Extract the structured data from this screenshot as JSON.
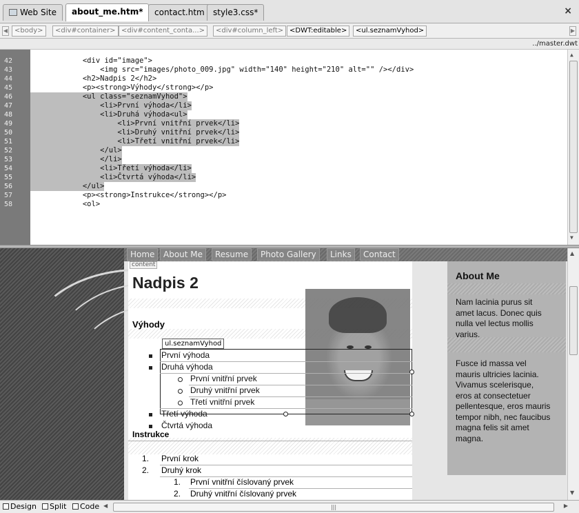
{
  "tabs": [
    {
      "label": "Web Site"
    },
    {
      "label": "about_me.htm*"
    },
    {
      "label": "contact.htm"
    },
    {
      "label": "style3.css*"
    }
  ],
  "close_label": "×",
  "tag_selector": [
    "<body>",
    "<div#container>",
    "<div#content_conta...>",
    "<div#column_left>",
    "<DWT:editable>",
    "<ul.seznamVyhod>"
  ],
  "template_path": "../master.dwt",
  "code_lines": [
    {
      "n": "42",
      "text": "            <div id=\"image\">"
    },
    {
      "n": "43",
      "text": "                <img src=\"images/photo_009.jpg\" width=\"140\" height=\"210\" alt=\"\" /></div>"
    },
    {
      "n": "44",
      "text": "            <h2>Nadpis 2</h2>"
    },
    {
      "n": "45",
      "text": "            <p><strong>Výhody</strong></p>"
    },
    {
      "n": "46",
      "text": "            <ul class=\"seznamVyhod\">"
    },
    {
      "n": "47",
      "text": "                <li>První výhoda</li>"
    },
    {
      "n": "48",
      "text": "                <li>Druhá výhoda<ul>"
    },
    {
      "n": "49",
      "text": "                    <li>První vnitřní prvek</li>"
    },
    {
      "n": "50",
      "text": "                    <li>Druhý vnitřní prvek</li>"
    },
    {
      "n": "51",
      "text": "                    <li>Třetí vnitřní prvek</li>"
    },
    {
      "n": "52",
      "text": "                </ul>"
    },
    {
      "n": "53",
      "text": "                </li>"
    },
    {
      "n": "54",
      "text": "                <li>Třetí výhoda</li>"
    },
    {
      "n": "55",
      "text": "                <li>Čtvrtá výhoda</li>"
    },
    {
      "n": "56",
      "text": "            </ul>"
    },
    {
      "n": "57",
      "text": "            <p><strong>Instrukce</strong></p>"
    },
    {
      "n": "58",
      "text": "            <ol>"
    }
  ],
  "nav": [
    "Home",
    "About Me",
    "Resume",
    "Photo Gallery",
    "Links",
    "Contact"
  ],
  "content_tag": "content",
  "heading": "Nadpis 2",
  "vyhody_label": "Výhody",
  "ul_tag_label": "ul.seznamVyhod",
  "list_items": [
    "První výhoda",
    "Druhá výhoda",
    "Třetí výhoda",
    "Čtvrtá výhoda"
  ],
  "inner_items": [
    "První vnitřní prvek",
    "Druhý vnitřní prvek",
    "Třetí vnitřní prvek"
  ],
  "instrukce_label": "Instrukce",
  "ol_items": [
    {
      "num": "1.",
      "text": "První krok"
    },
    {
      "num": "2.",
      "text": "Druhý krok"
    }
  ],
  "ol_inner": [
    {
      "num": "1.",
      "text": "První vnitřní číslovaný prvek"
    },
    {
      "num": "2.",
      "text": "Druhý vnitřní číslovaný prvek"
    }
  ],
  "sidebar": {
    "title": "About Me",
    "para1": [
      "Nam lacinia purus sit",
      "amet lacus. Donec quis",
      "nulla vel lectus mollis",
      "varius."
    ],
    "para2": [
      "Fusce id massa vel",
      "mauris ultricies lacinia.",
      "Vivamus scelerisque,",
      "eros at consectetuer",
      "pellentesque, eros mauris",
      "tempor nibh, nec faucibus",
      "magna felis sit amet",
      "magna."
    ]
  },
  "view_buttons": [
    "Design",
    "Split",
    "Code"
  ],
  "colors": {
    "gutter": "#7a7a7a",
    "selection": "#bdbdbd",
    "sidebar": "#b3b3b3"
  }
}
